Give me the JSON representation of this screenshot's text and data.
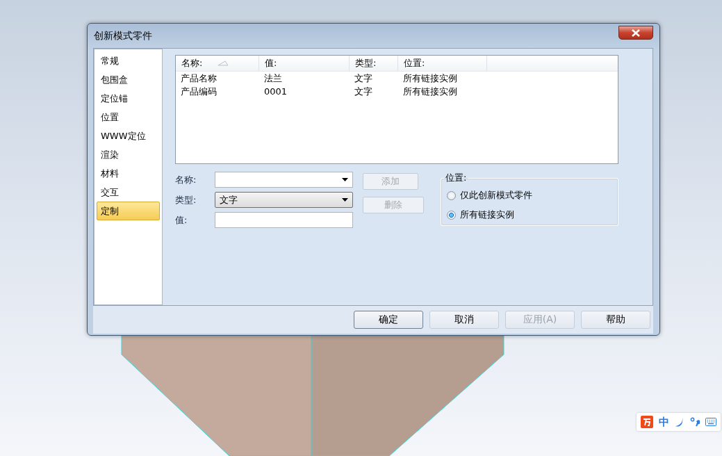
{
  "window": {
    "title": "创新模式零件"
  },
  "sidebar": {
    "items": [
      {
        "label": "常规",
        "selected": false
      },
      {
        "label": "包围盒",
        "selected": false
      },
      {
        "label": "定位锚",
        "selected": false
      },
      {
        "label": "位置",
        "selected": false
      },
      {
        "label": "WWW定位",
        "selected": false
      },
      {
        "label": "渲染",
        "selected": false
      },
      {
        "label": "材料",
        "selected": false
      },
      {
        "label": "交互",
        "selected": false
      },
      {
        "label": "定制",
        "selected": true
      }
    ]
  },
  "table": {
    "columns": [
      {
        "label": "名称:",
        "sorted": true
      },
      {
        "label": "值:",
        "sorted": false
      },
      {
        "label": "类型:",
        "sorted": false
      },
      {
        "label": "位置:",
        "sorted": false
      }
    ],
    "rows": [
      [
        "产品名称",
        "法兰",
        "文字",
        "所有链接实例"
      ],
      [
        "产品编码",
        "0001",
        "文字",
        "所有链接实例"
      ]
    ]
  },
  "form": {
    "fields": [
      {
        "label": "名称:",
        "kind": "combo"
      },
      {
        "label": "类型:",
        "kind": "combo",
        "value": "文字"
      },
      {
        "label": "值:",
        "kind": "text"
      }
    ],
    "buttons": [
      {
        "label": "添加",
        "disabled": true
      },
      {
        "label": "删除",
        "disabled": true
      }
    ],
    "location_group": {
      "title": "位置:",
      "options": [
        {
          "label": "仅此创新模式零件",
          "selected": false
        },
        {
          "label": "所有链接实例",
          "selected": true
        }
      ]
    }
  },
  "footer_buttons": [
    {
      "label": "确定",
      "disabled": false,
      "default": true
    },
    {
      "label": "取消",
      "disabled": false,
      "default": false
    },
    {
      "label": "应用(A)",
      "disabled": true,
      "default": false
    },
    {
      "label": "帮助",
      "disabled": false,
      "default": false
    }
  ],
  "ime_bar": {
    "mode": "中"
  }
}
